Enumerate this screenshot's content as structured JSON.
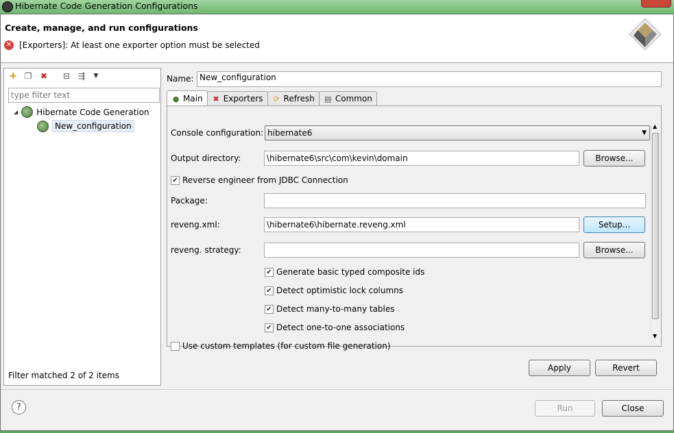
{
  "window": {
    "title": "Hibernate Code Generation Configurations"
  },
  "header": {
    "title": "Create, manage, and run configurations",
    "error_message": "[Exporters]: At least one exporter option must be selected"
  },
  "left_panel": {
    "filter_placeholder": "type filter text",
    "tree": [
      {
        "label": "Hibernate Code Generation"
      },
      {
        "label": "New_configuration"
      }
    ],
    "filter_status": "Filter matched 2 of 2 items"
  },
  "config": {
    "name_label": "Name:",
    "name_value": "New_configuration",
    "tabs": [
      {
        "label": "Main"
      },
      {
        "label": "Exporters"
      },
      {
        "label": "Refresh"
      },
      {
        "label": "Common"
      }
    ],
    "main": {
      "console_label": "Console configuration:",
      "console_value": "hibernate6",
      "output_label": "Output directory:",
      "output_value": "\\hibernate6\\src\\com\\kevin\\domain",
      "browse_label": "Browse...",
      "reverse_label": "Reverse engineer from JDBC Connection",
      "package_label": "Package:",
      "package_value": "",
      "reveng_xml_label": "reveng.xml:",
      "reveng_xml_value": "\\hibernate6\\hibernate.reveng.xml",
      "setup_label": "Setup...",
      "strategy_label": "reveng. strategy:",
      "strategy_value": "",
      "options": [
        {
          "label": "Generate basic typed composite ids",
          "checked": true
        },
        {
          "label": "Detect optimistic lock columns",
          "checked": true
        },
        {
          "label": "Detect many-to-many tables",
          "checked": true
        },
        {
          "label": "Detect one-to-one associations",
          "checked": true
        }
      ],
      "custom_templates_label": "Use custom templates (for custom file generation)"
    },
    "apply_label": "Apply",
    "revert_label": "Revert"
  },
  "footer": {
    "run_label": "Run",
    "close_label": "Close"
  }
}
